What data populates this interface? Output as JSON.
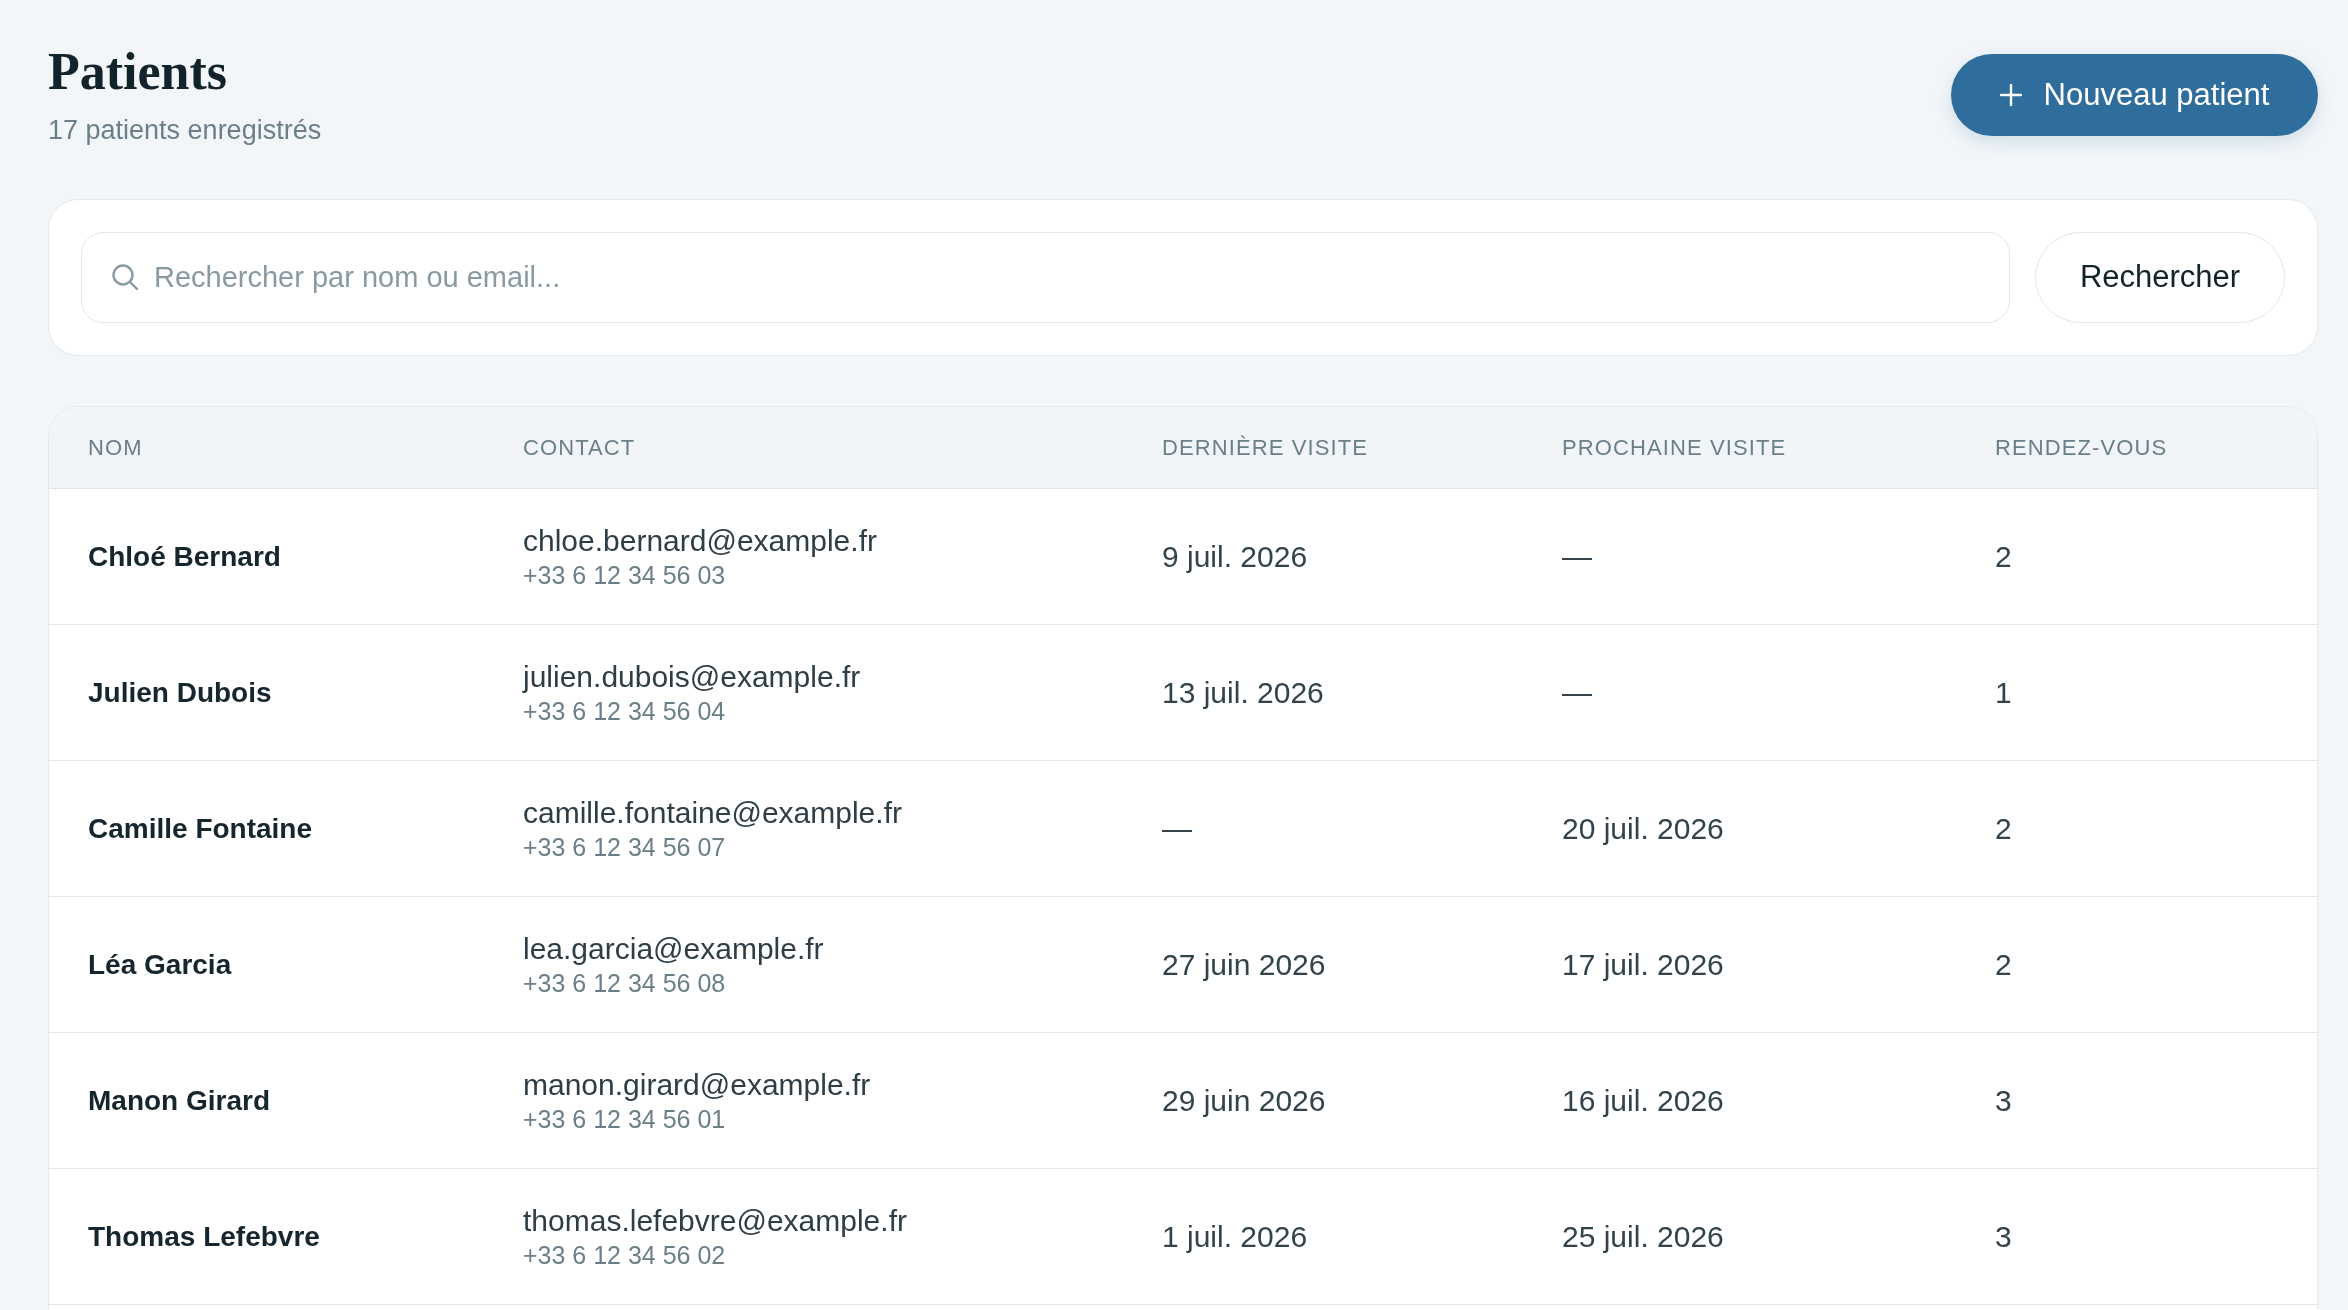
{
  "header": {
    "title": "Patients",
    "subtitle": "17 patients enregistrés",
    "new_button": {
      "label": "Nouveau patient"
    }
  },
  "search": {
    "placeholder": "Rechercher par nom ou email...",
    "button": "Rechercher"
  },
  "table": {
    "columns": [
      "NOM",
      "CONTACT",
      "DERNIÈRE VISITE",
      "PROCHAINE VISITE",
      "RENDEZ-VOUS"
    ],
    "rows": [
      {
        "name": "Chloé Bernard",
        "email": "chloe.bernard@example.fr",
        "phone": "+33 6 12 34 56 03",
        "last_visit": "9 juil. 2026",
        "next_visit": "—",
        "appointments": "2"
      },
      {
        "name": "Julien Dubois",
        "email": "julien.dubois@example.fr",
        "phone": "+33 6 12 34 56 04",
        "last_visit": "13 juil. 2026",
        "next_visit": "—",
        "appointments": "1"
      },
      {
        "name": "Camille Fontaine",
        "email": "camille.fontaine@example.fr",
        "phone": "+33 6 12 34 56 07",
        "last_visit": "—",
        "next_visit": "20 juil. 2026",
        "appointments": "2"
      },
      {
        "name": "Léa Garcia",
        "email": "lea.garcia@example.fr",
        "phone": "+33 6 12 34 56 08",
        "last_visit": "27 juin 2026",
        "next_visit": "17 juil. 2026",
        "appointments": "2"
      },
      {
        "name": "Manon Girard",
        "email": "manon.girard@example.fr",
        "phone": "+33 6 12 34 56 01",
        "last_visit": "29 juin 2026",
        "next_visit": "16 juil. 2026",
        "appointments": "3"
      },
      {
        "name": "Thomas Lefebvre",
        "email": "thomas.lefebvre@example.fr",
        "phone": "+33 6 12 34 56 02",
        "last_visit": "1 juil. 2026",
        "next_visit": "25 juil. 2026",
        "appointments": "3"
      }
    ]
  }
}
